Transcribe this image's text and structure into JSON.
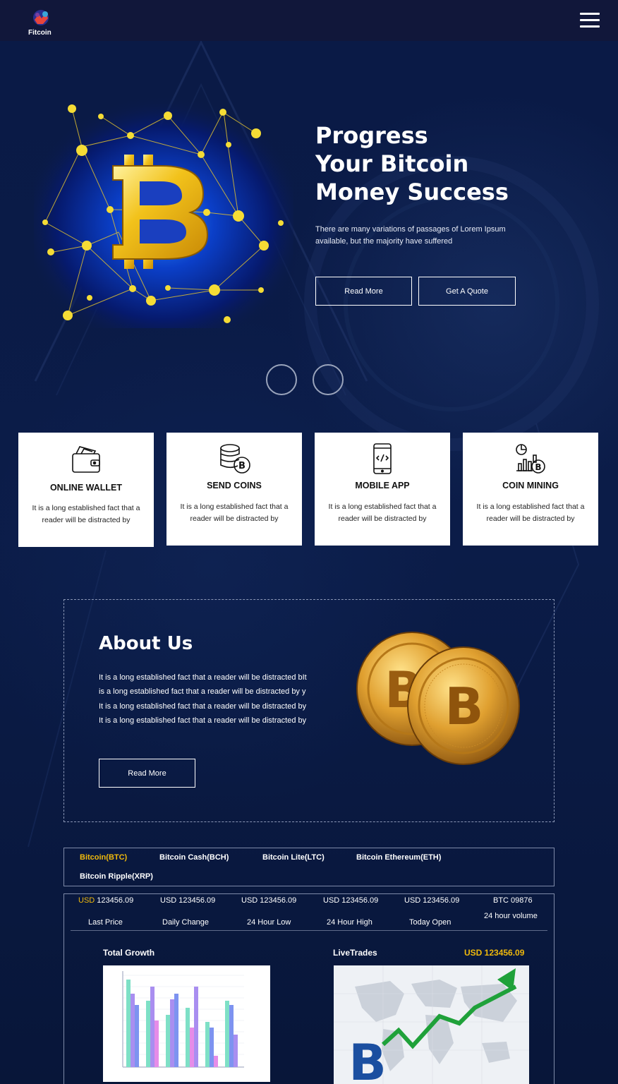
{
  "brand": {
    "name": "Fitcoin"
  },
  "hero": {
    "title_lines": [
      "Progress",
      "Your Bitcoin",
      "Money Success"
    ],
    "description": "There are many variations of passages of Lorem Ipsum available, but the majority have suffered",
    "read_more_label": "Read More",
    "quote_label": "Get A Quote"
  },
  "features": [
    {
      "title": "ONLINE WALLET",
      "text": "It is a long established fact that a reader will be distracted by",
      "icon": "wallet-icon"
    },
    {
      "title": "SEND COINS",
      "text": "It is a long established fact that a reader will be distracted by",
      "icon": "coins-stack-icon"
    },
    {
      "title": "MOBILE APP",
      "text": "It is a long established fact that a reader will be distracted by",
      "icon": "mobile-app-icon"
    },
    {
      "title": "COIN MINING",
      "text": "It is a long established fact that a reader will be distracted by",
      "icon": "mining-chart-icon"
    }
  ],
  "about": {
    "title": "About Us",
    "text": "It is a long established fact that a reader will be distracted bIt is a long established fact that a reader will be distracted by y It is a long established fact that a reader will be distracted by It is a long established fact that a reader will be distracted by",
    "button_label": "Read More"
  },
  "tabs": [
    {
      "label": "Bitcoin(BTC)",
      "active": true
    },
    {
      "label": "Bitcoin Cash(BCH)",
      "active": false
    },
    {
      "label": "Bitcoin Lite(LTC)",
      "active": false
    },
    {
      "label": "Bitcoin Ethereum(ETH)",
      "active": false
    },
    {
      "label": "Bitcoin Ripple(XRP)",
      "active": false
    }
  ],
  "stats": [
    {
      "currency": "USD",
      "value": "123456.09",
      "label": "Last Price"
    },
    {
      "currency": "",
      "value": "USD 123456.09",
      "label": "Daily Change"
    },
    {
      "currency": "",
      "value": "USD 123456.09",
      "label": "24 Hour Low"
    },
    {
      "currency": "",
      "value": "USD 123456.09",
      "label": "24 Hour High"
    },
    {
      "currency": "",
      "value": "USD 123456.09",
      "label": "Today Open"
    },
    {
      "currency": "",
      "value": "BTC 09876",
      "label": "24 hour volume"
    }
  ],
  "growth": {
    "title": "Total Growth"
  },
  "live": {
    "title": "LiveTrades",
    "price": "USD 123456.09"
  },
  "colors": {
    "accent": "#f0b90b",
    "background": "#0b1b45",
    "navbar": "#11173a"
  }
}
